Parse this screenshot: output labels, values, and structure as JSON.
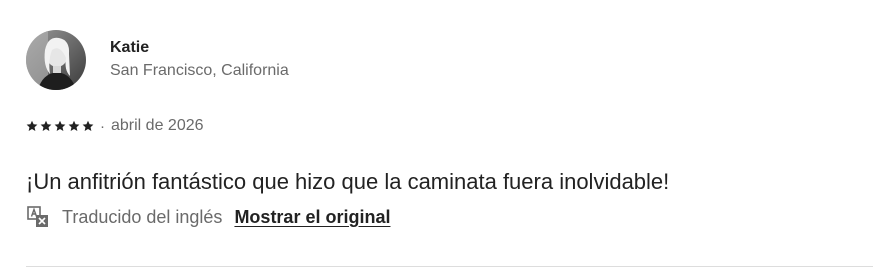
{
  "review": {
    "author": {
      "name": "Katie",
      "location": "San Francisco, California",
      "avatar_icon": "person-photo"
    },
    "rating": {
      "stars": 5,
      "max_stars": 5,
      "separator": "·",
      "date": "abril de 2026"
    },
    "text": "¡Un anfitrión fantástico que hizo que la caminata fuera inolvidable!",
    "translation": {
      "icon": "translate-icon",
      "label": "Traducido del inglés",
      "show_original_label": "Mostrar el original"
    }
  },
  "colors": {
    "primary_text": "#222222",
    "secondary_text": "#6a6a6a",
    "divider": "#dddddd"
  }
}
